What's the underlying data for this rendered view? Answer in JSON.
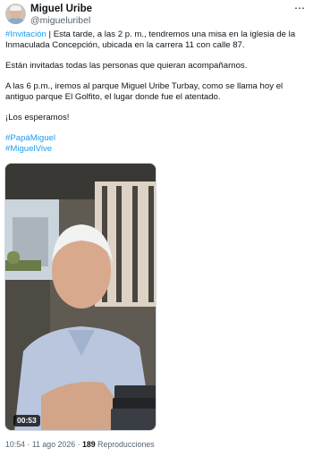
{
  "author": {
    "name": "Miguel Uribe",
    "handle": "@migueluribel"
  },
  "more_icon": "more-dots-icon",
  "tweet": {
    "p1_hashtag": "#Invitación",
    "p1_text": " | Esta tarde, a las  2 p. m., tendremos una misa en la iglesia de la Inmaculada Concepción, ubicada en la carrera 11 con calle 87.",
    "p2": "Están invitadas todas las personas que quieran acompañarnos.",
    "p3": "A las 6 p.m., iremos al parque Miguel Uribe Turbay, como se llama hoy el antiguo parque El Golfito, el lugar donde fue el atentado.",
    "p4": "¡Los esperamos!",
    "hashtags": [
      "#PapáMiguel",
      "#MiguelVive"
    ]
  },
  "video": {
    "duration": "00:53"
  },
  "meta": {
    "time": "10:54",
    "separator": " · ",
    "date": "11 ago 2026",
    "views": "189",
    "views_label": " Reproducciones"
  }
}
